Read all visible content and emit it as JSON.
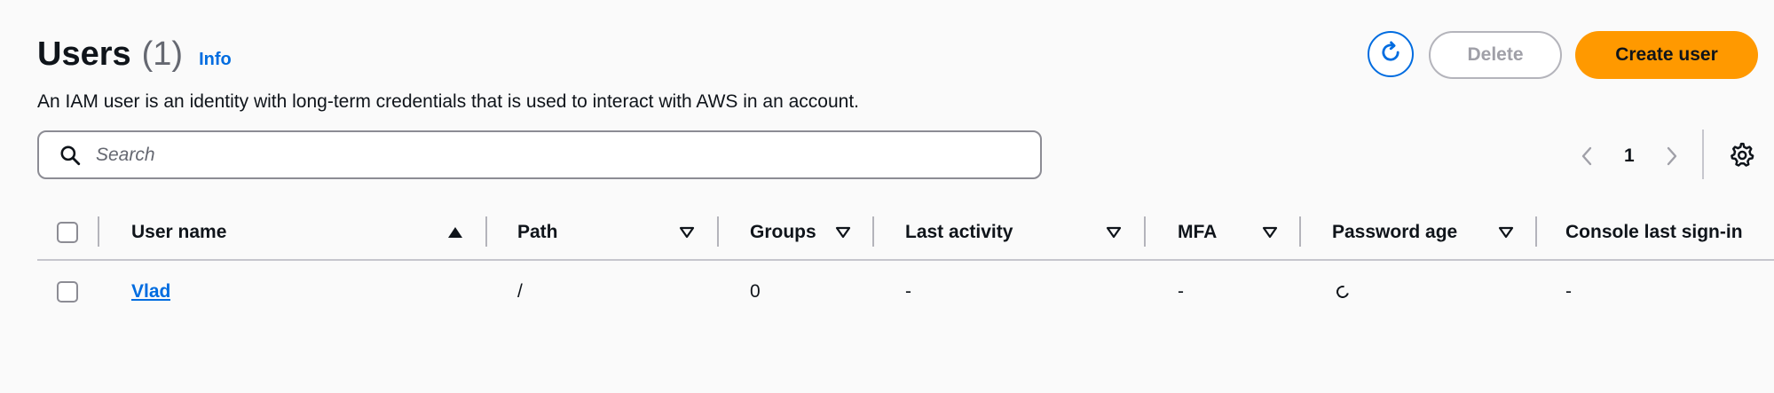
{
  "header": {
    "title": "Users",
    "count": "(1)",
    "info": "Info",
    "description": "An IAM user is an identity with long-term credentials that is used to interact with AWS in an account."
  },
  "actions": {
    "refresh_icon": "refresh-icon",
    "delete_label": "Delete",
    "create_label": "Create user",
    "delete_disabled": true
  },
  "search": {
    "placeholder": "Search",
    "value": ""
  },
  "pagination": {
    "current_page": "1",
    "prev_icon": "chevron-left-icon",
    "next_icon": "chevron-right-icon",
    "settings_icon": "gear-icon"
  },
  "table": {
    "columns": [
      {
        "label": "User name",
        "sort": "ascending"
      },
      {
        "label": "Path",
        "sort": "none"
      },
      {
        "label": "Groups",
        "sort": "none"
      },
      {
        "label": "Last activity",
        "sort": "none"
      },
      {
        "label": "MFA",
        "sort": "none"
      },
      {
        "label": "Password age",
        "sort": "none"
      },
      {
        "label": "Console last sign-in",
        "sort": "none"
      }
    ],
    "rows": [
      {
        "user_name": "Vlad",
        "path": "/",
        "groups": "0",
        "last_activity": "-",
        "mfa": "-",
        "password_age": "loading",
        "console_last_sign_in": "-"
      }
    ]
  },
  "colors": {
    "accent": "#006ce0",
    "primary_button": "#ff9900",
    "disabled_text": "#a0a0a8",
    "border": "#8c8c94"
  }
}
